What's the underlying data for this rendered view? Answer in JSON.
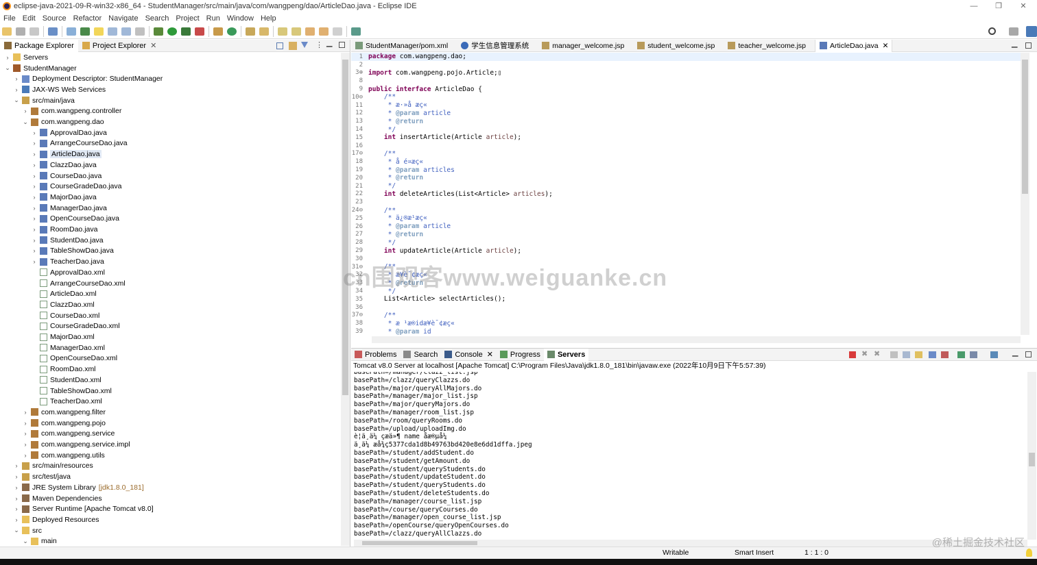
{
  "window": {
    "title": "eclipse-java-2021-09-R-win32-x86_64 - StudentManager/src/main/java/com/wangpeng/dao/ArticleDao.java - Eclipse IDE",
    "minimize": "—",
    "maximize": "❐",
    "close": "✕"
  },
  "menu": [
    "File",
    "Edit",
    "Source",
    "Refactor",
    "Navigate",
    "Search",
    "Project",
    "Run",
    "Window",
    "Help"
  ],
  "left_panel": {
    "tabs": [
      {
        "label": "Package Explorer",
        "icon": "package-explorer-icon"
      },
      {
        "label": "Project Explorer",
        "icon": "project-explorer-icon"
      }
    ],
    "close_glyph": "✕",
    "tree": [
      {
        "label": "Servers",
        "level": 0,
        "twisty": "›",
        "icon": "folder"
      },
      {
        "label": "StudentManager",
        "level": 0,
        "twisty": "⌄",
        "icon": "project"
      },
      {
        "label": "Deployment Descriptor: StudentManager",
        "level": 1,
        "twisty": "›",
        "icon": "descriptor"
      },
      {
        "label": "JAX-WS Web Services",
        "level": 1,
        "twisty": "›",
        "icon": "webservice"
      },
      {
        "label": "src/main/java",
        "level": 1,
        "twisty": "⌄",
        "icon": "srcfolder"
      },
      {
        "label": "com.wangpeng.controller",
        "level": 2,
        "twisty": "›",
        "icon": "package"
      },
      {
        "label": "com.wangpeng.dao",
        "level": 2,
        "twisty": "⌄",
        "icon": "package"
      },
      {
        "label": "ApprovalDao.java",
        "level": 3,
        "twisty": "›",
        "icon": "java"
      },
      {
        "label": "ArrangeCourseDao.java",
        "level": 3,
        "twisty": "›",
        "icon": "java"
      },
      {
        "label": "ArticleDao.java",
        "level": 3,
        "twisty": "›",
        "icon": "java",
        "selected": true
      },
      {
        "label": "ClazzDao.java",
        "level": 3,
        "twisty": "›",
        "icon": "java"
      },
      {
        "label": "CourseDao.java",
        "level": 3,
        "twisty": "›",
        "icon": "java"
      },
      {
        "label": "CourseGradeDao.java",
        "level": 3,
        "twisty": "›",
        "icon": "java"
      },
      {
        "label": "MajorDao.java",
        "level": 3,
        "twisty": "›",
        "icon": "java"
      },
      {
        "label": "ManagerDao.java",
        "level": 3,
        "twisty": "›",
        "icon": "java"
      },
      {
        "label": "OpenCourseDao.java",
        "level": 3,
        "twisty": "›",
        "icon": "java"
      },
      {
        "label": "RoomDao.java",
        "level": 3,
        "twisty": "›",
        "icon": "java"
      },
      {
        "label": "StudentDao.java",
        "level": 3,
        "twisty": "›",
        "icon": "java"
      },
      {
        "label": "TableShowDao.java",
        "level": 3,
        "twisty": "›",
        "icon": "java"
      },
      {
        "label": "TeacherDao.java",
        "level": 3,
        "twisty": "›",
        "icon": "java"
      },
      {
        "label": "ApprovalDao.xml",
        "level": 3,
        "twisty": "",
        "icon": "xml"
      },
      {
        "label": "ArrangeCourseDao.xml",
        "level": 3,
        "twisty": "",
        "icon": "xml"
      },
      {
        "label": "ArticleDao.xml",
        "level": 3,
        "twisty": "",
        "icon": "xml"
      },
      {
        "label": "ClazzDao.xml",
        "level": 3,
        "twisty": "",
        "icon": "xml"
      },
      {
        "label": "CourseDao.xml",
        "level": 3,
        "twisty": "",
        "icon": "xml"
      },
      {
        "label": "CourseGradeDao.xml",
        "level": 3,
        "twisty": "",
        "icon": "xml"
      },
      {
        "label": "MajorDao.xml",
        "level": 3,
        "twisty": "",
        "icon": "xml"
      },
      {
        "label": "ManagerDao.xml",
        "level": 3,
        "twisty": "",
        "icon": "xml"
      },
      {
        "label": "OpenCourseDao.xml",
        "level": 3,
        "twisty": "",
        "icon": "xml"
      },
      {
        "label": "RoomDao.xml",
        "level": 3,
        "twisty": "",
        "icon": "xml"
      },
      {
        "label": "StudentDao.xml",
        "level": 3,
        "twisty": "",
        "icon": "xml"
      },
      {
        "label": "TableShowDao.xml",
        "level": 3,
        "twisty": "",
        "icon": "xml"
      },
      {
        "label": "TeacherDao.xml",
        "level": 3,
        "twisty": "",
        "icon": "xml"
      },
      {
        "label": "com.wangpeng.filter",
        "level": 2,
        "twisty": "›",
        "icon": "package"
      },
      {
        "label": "com.wangpeng.pojo",
        "level": 2,
        "twisty": "›",
        "icon": "package"
      },
      {
        "label": "com.wangpeng.service",
        "level": 2,
        "twisty": "›",
        "icon": "package"
      },
      {
        "label": "com.wangpeng.service.impl",
        "level": 2,
        "twisty": "›",
        "icon": "package"
      },
      {
        "label": "com.wangpeng.utils",
        "level": 2,
        "twisty": "›",
        "icon": "package"
      },
      {
        "label": "src/main/resources",
        "level": 1,
        "twisty": "›",
        "icon": "srcfolder"
      },
      {
        "label": "src/test/java",
        "level": 1,
        "twisty": "›",
        "icon": "srcfolder"
      },
      {
        "label": "JRE System Library",
        "suffix": "[jdk1.8.0_181]",
        "level": 1,
        "twisty": "›",
        "icon": "library"
      },
      {
        "label": "Maven Dependencies",
        "level": 1,
        "twisty": "›",
        "icon": "library"
      },
      {
        "label": "Server Runtime [Apache Tomcat v8.0]",
        "level": 1,
        "twisty": "›",
        "icon": "library"
      },
      {
        "label": "Deployed Resources",
        "level": 1,
        "twisty": "›",
        "icon": "folder"
      },
      {
        "label": "src",
        "level": 1,
        "twisty": "⌄",
        "icon": "folder"
      },
      {
        "label": "main",
        "level": 2,
        "twisty": "⌄",
        "icon": "folder"
      }
    ]
  },
  "editor": {
    "tabs": [
      {
        "label": "StudentManager/pom.xml",
        "icon": "xml"
      },
      {
        "label": "学生信息管理系统",
        "icon": "globe"
      },
      {
        "label": "manager_welcome.jsp",
        "icon": "jsp"
      },
      {
        "label": "student_welcome.jsp",
        "icon": "jsp"
      },
      {
        "label": "teacher_welcome.jsp",
        "icon": "jsp"
      },
      {
        "label": "ArticleDao.java",
        "icon": "java",
        "active": true
      }
    ],
    "lines": [
      {
        "n": "1",
        "segs": [
          [
            "kw",
            "package"
          ],
          [
            "t",
            " com.wangpeng.dao;"
          ]
        ]
      },
      {
        "n": "2",
        "segs": []
      },
      {
        "n": "3⊕",
        "segs": [
          [
            "kw",
            "import"
          ],
          [
            "t",
            " com.wangpeng.pojo.Article;▯"
          ]
        ]
      },
      {
        "n": "8",
        "segs": []
      },
      {
        "n": "9",
        "segs": [
          [
            "kw",
            "public interface"
          ],
          [
            "t",
            " ArticleDao {"
          ]
        ]
      },
      {
        "n": "10⊖",
        "segs": [
          [
            "cm",
            "    /**"
          ]
        ]
      },
      {
        "n": "11",
        "segs": [
          [
            "cm",
            "     * æ·»å æç«"
          ]
        ]
      },
      {
        "n": "12",
        "segs": [
          [
            "cm",
            "     * "
          ],
          [
            "pm",
            "@param"
          ],
          [
            "cm",
            " article"
          ]
        ]
      },
      {
        "n": "13",
        "segs": [
          [
            "cm",
            "     * "
          ],
          [
            "pm",
            "@return"
          ]
        ]
      },
      {
        "n": "14",
        "segs": [
          [
            "cm",
            "     */"
          ]
        ]
      },
      {
        "n": "15",
        "segs": [
          [
            "t",
            "    "
          ],
          [
            "kw",
            "int"
          ],
          [
            "t",
            " insertArticle(Article "
          ],
          [
            "par",
            "article"
          ],
          [
            "t",
            ");"
          ]
        ]
      },
      {
        "n": "16",
        "segs": []
      },
      {
        "n": "17⊖",
        "segs": [
          [
            "cm",
            "    /**"
          ]
        ]
      },
      {
        "n": "18",
        "segs": [
          [
            "cm",
            "     * å é¤æç«"
          ]
        ]
      },
      {
        "n": "19",
        "segs": [
          [
            "cm",
            "     * "
          ],
          [
            "pm",
            "@param"
          ],
          [
            "cm",
            " articles"
          ]
        ]
      },
      {
        "n": "20",
        "segs": [
          [
            "cm",
            "     * "
          ],
          [
            "pm",
            "@return"
          ]
        ]
      },
      {
        "n": "21",
        "segs": [
          [
            "cm",
            "     */"
          ]
        ]
      },
      {
        "n": "22",
        "segs": [
          [
            "t",
            "    "
          ],
          [
            "kw",
            "int"
          ],
          [
            "t",
            " deleteArticles(List<Article> "
          ],
          [
            "par",
            "articles"
          ],
          [
            "t",
            ");"
          ]
        ]
      },
      {
        "n": "23",
        "segs": []
      },
      {
        "n": "24⊖",
        "segs": [
          [
            "cm",
            "    /**"
          ]
        ]
      },
      {
        "n": "25",
        "segs": [
          [
            "cm",
            "     * ä¿®æ¹æç«"
          ]
        ]
      },
      {
        "n": "26",
        "segs": [
          [
            "cm",
            "     * "
          ],
          [
            "pm",
            "@param"
          ],
          [
            "cm",
            " article"
          ]
        ]
      },
      {
        "n": "27",
        "segs": [
          [
            "cm",
            "     * "
          ],
          [
            "pm",
            "@return"
          ]
        ]
      },
      {
        "n": "28",
        "segs": [
          [
            "cm",
            "     */"
          ]
        ]
      },
      {
        "n": "29",
        "segs": [
          [
            "t",
            "    "
          ],
          [
            "kw",
            "int"
          ],
          [
            "t",
            " updateArticle(Article "
          ],
          [
            "par",
            "article"
          ],
          [
            "t",
            ");"
          ]
        ]
      },
      {
        "n": "30",
        "segs": []
      },
      {
        "n": "31⊖",
        "segs": [
          [
            "cm",
            "    /**"
          ]
        ]
      },
      {
        "n": "32",
        "segs": [
          [
            "cm",
            "     * æ¥è¯¢æç«"
          ]
        ]
      },
      {
        "n": "33",
        "segs": [
          [
            "cm",
            "     * "
          ],
          [
            "pm",
            "@return"
          ]
        ]
      },
      {
        "n": "34",
        "segs": [
          [
            "cm",
            "     */"
          ]
        ]
      },
      {
        "n": "35",
        "segs": [
          [
            "t",
            "    List<Article> selectArticles();"
          ]
        ]
      },
      {
        "n": "36",
        "segs": []
      },
      {
        "n": "37⊖",
        "segs": [
          [
            "cm",
            "    /**"
          ]
        ]
      },
      {
        "n": "38",
        "segs": [
          [
            "cm",
            "     * æ ¹æ®idæ¥è¯¢æç«"
          ]
        ]
      },
      {
        "n": "39",
        "segs": [
          [
            "cm",
            "     * "
          ],
          [
            "pm",
            "@param"
          ],
          [
            "cm",
            " id"
          ]
        ]
      }
    ]
  },
  "bottom_panel": {
    "tabs": [
      {
        "label": "Problems",
        "icon": "problems-icon"
      },
      {
        "label": "Search",
        "icon": "search-icon"
      },
      {
        "label": "Console",
        "icon": "console-icon",
        "closable": true
      },
      {
        "label": "Progress",
        "icon": "progress-icon"
      },
      {
        "label": "Servers",
        "icon": "servers-icon",
        "active": true
      }
    ],
    "header": "Tomcat v8.0 Server at localhost [Apache Tomcat] C:\\Program Files\\Java\\jdk1.8.0_181\\bin\\javaw.exe  (2022年10月9日下午5:57:39)",
    "lines": [
      "basePath=/manager/clazz_list.jsp",
      "basePath=/clazz/queryClazzs.do",
      "basePath=/major/queryAllMajors.do",
      "basePath=/manager/major_list.jsp",
      "basePath=/major/queryMajors.do",
      "basePath=/manager/room_list.jsp",
      "basePath=/room/queryRooms.do",
      "basePath=/upload/uploadImg.do",
      "è¦ä¸ä¼ çæä»¶ name å­æ®µå¼",
      "ä¸ä¼ æå¾ç5377cda1d8b49763bd420e8e6dd1dffa.jpeg",
      "basePath=/student/addStudent.do",
      "basePath=/student/getAmount.do",
      "basePath=/student/queryStudents.do",
      "basePath=/student/updateStudent.do",
      "basePath=/student/queryStudents.do",
      "basePath=/student/deleteStudents.do",
      "basePath=/manager/course_list.jsp",
      "basePath=/course/queryCourses.do",
      "basePath=/manager/open_course_list.jsp",
      "basePath=/openCourse/queryOpenCourses.do",
      "basePath=/clazz/queryAllClazzs.do"
    ]
  },
  "status": {
    "writable": "Writable",
    "insert_mode": "Smart Insert",
    "position": "1 : 1 : 0"
  },
  "watermark": "cn围观客www.weiguanke.cn",
  "watermark2": "@稀土掘金技术社区",
  "colors": {
    "keyword": "#7f0055",
    "comment": "#3f5fbf",
    "javadoc_tag": "#7f9fbf",
    "parameter": "#6a3e3e",
    "selection": "#e0e8f4"
  }
}
